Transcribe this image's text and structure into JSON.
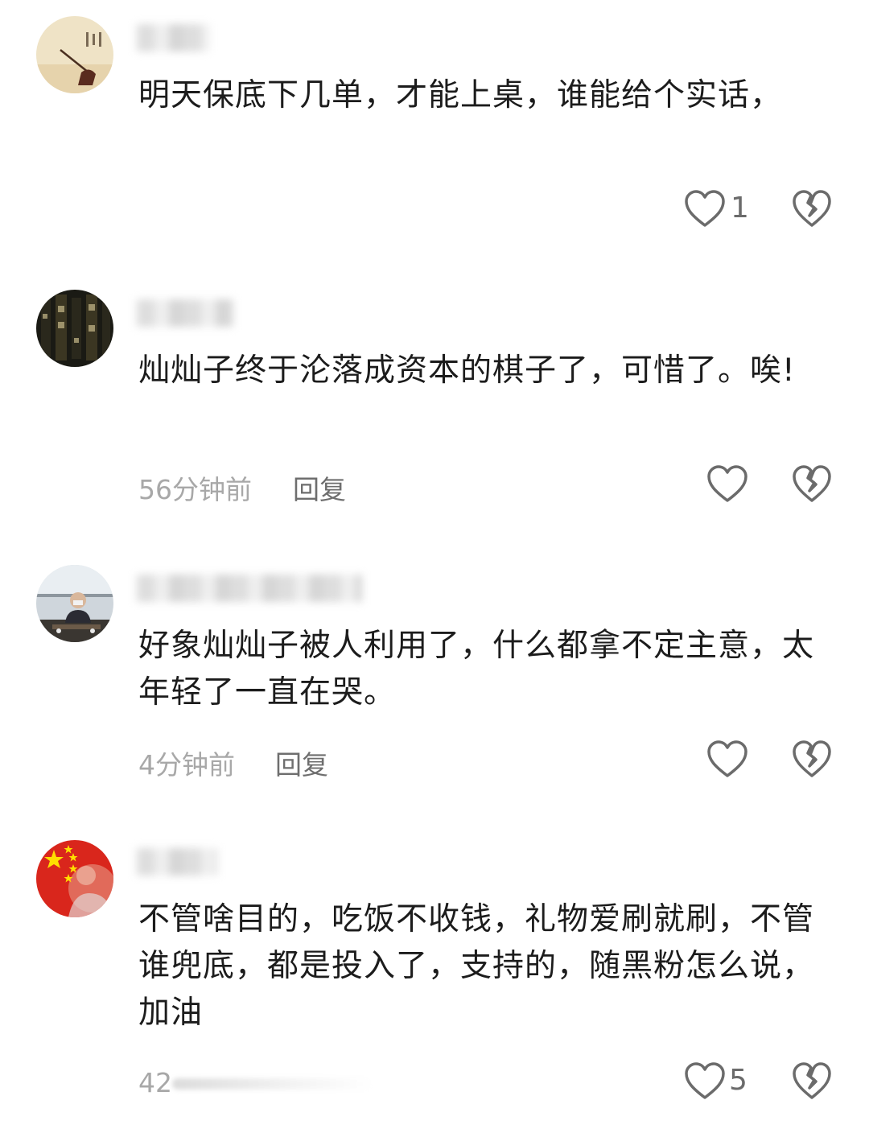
{
  "comments": [
    {
      "text": "明天保底下几单，才能上桌，谁能给个实话，",
      "time": "",
      "reply_label": "",
      "like_count": "1"
    },
    {
      "text": "灿灿子终于沦落成资本的棋子了，可惜了。唉!",
      "time": "56分钟前",
      "reply_label": "回复",
      "like_count": ""
    },
    {
      "text": "好象灿灿子被人利用了，什么都拿不定主意，太年轻了一直在哭。",
      "time": "4分钟前",
      "reply_label": "回复",
      "like_count": ""
    },
    {
      "text": "不管啥目的，吃饭不收钱，礼物爱刷就刷，不管谁兜底，都是投入了，支持的，随黑粉怎么说，加油",
      "time": "42",
      "reply_label": "",
      "like_count": "5"
    }
  ],
  "icons": {
    "like": "heart-outline-icon",
    "dislike": "broken-heart-icon"
  },
  "colors": {
    "text": "#1c1c1c",
    "meta": "#a8a8a8",
    "reply": "#6e6e6e",
    "icon": "#6b6b6b"
  }
}
